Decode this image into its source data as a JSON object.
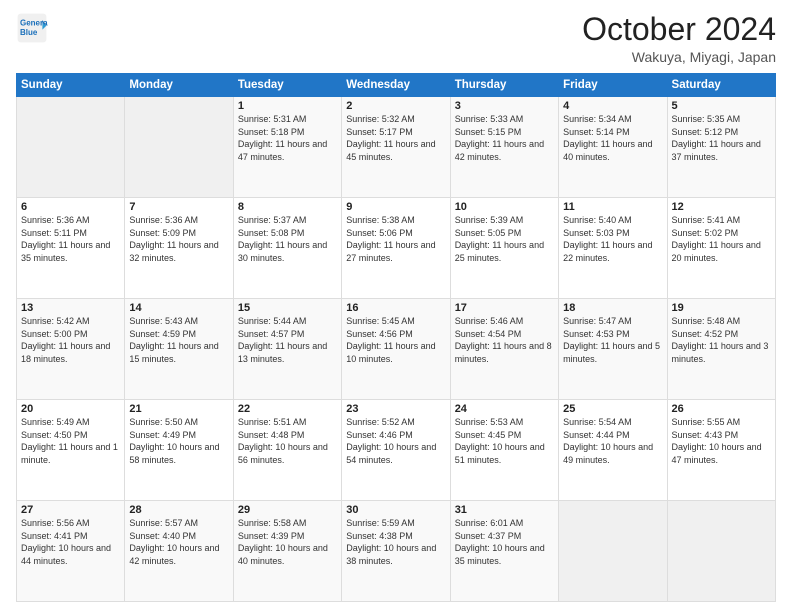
{
  "header": {
    "logo_line1": "General",
    "logo_line2": "Blue",
    "month": "October 2024",
    "location": "Wakuya, Miyagi, Japan"
  },
  "weekdays": [
    "Sunday",
    "Monday",
    "Tuesday",
    "Wednesday",
    "Thursday",
    "Friday",
    "Saturday"
  ],
  "weeks": [
    [
      {
        "day": "",
        "data": ""
      },
      {
        "day": "",
        "data": ""
      },
      {
        "day": "1",
        "data": "Sunrise: 5:31 AM\nSunset: 5:18 PM\nDaylight: 11 hours and 47 minutes."
      },
      {
        "day": "2",
        "data": "Sunrise: 5:32 AM\nSunset: 5:17 PM\nDaylight: 11 hours and 45 minutes."
      },
      {
        "day": "3",
        "data": "Sunrise: 5:33 AM\nSunset: 5:15 PM\nDaylight: 11 hours and 42 minutes."
      },
      {
        "day": "4",
        "data": "Sunrise: 5:34 AM\nSunset: 5:14 PM\nDaylight: 11 hours and 40 minutes."
      },
      {
        "day": "5",
        "data": "Sunrise: 5:35 AM\nSunset: 5:12 PM\nDaylight: 11 hours and 37 minutes."
      }
    ],
    [
      {
        "day": "6",
        "data": "Sunrise: 5:36 AM\nSunset: 5:11 PM\nDaylight: 11 hours and 35 minutes."
      },
      {
        "day": "7",
        "data": "Sunrise: 5:36 AM\nSunset: 5:09 PM\nDaylight: 11 hours and 32 minutes."
      },
      {
        "day": "8",
        "data": "Sunrise: 5:37 AM\nSunset: 5:08 PM\nDaylight: 11 hours and 30 minutes."
      },
      {
        "day": "9",
        "data": "Sunrise: 5:38 AM\nSunset: 5:06 PM\nDaylight: 11 hours and 27 minutes."
      },
      {
        "day": "10",
        "data": "Sunrise: 5:39 AM\nSunset: 5:05 PM\nDaylight: 11 hours and 25 minutes."
      },
      {
        "day": "11",
        "data": "Sunrise: 5:40 AM\nSunset: 5:03 PM\nDaylight: 11 hours and 22 minutes."
      },
      {
        "day": "12",
        "data": "Sunrise: 5:41 AM\nSunset: 5:02 PM\nDaylight: 11 hours and 20 minutes."
      }
    ],
    [
      {
        "day": "13",
        "data": "Sunrise: 5:42 AM\nSunset: 5:00 PM\nDaylight: 11 hours and 18 minutes."
      },
      {
        "day": "14",
        "data": "Sunrise: 5:43 AM\nSunset: 4:59 PM\nDaylight: 11 hours and 15 minutes."
      },
      {
        "day": "15",
        "data": "Sunrise: 5:44 AM\nSunset: 4:57 PM\nDaylight: 11 hours and 13 minutes."
      },
      {
        "day": "16",
        "data": "Sunrise: 5:45 AM\nSunset: 4:56 PM\nDaylight: 11 hours and 10 minutes."
      },
      {
        "day": "17",
        "data": "Sunrise: 5:46 AM\nSunset: 4:54 PM\nDaylight: 11 hours and 8 minutes."
      },
      {
        "day": "18",
        "data": "Sunrise: 5:47 AM\nSunset: 4:53 PM\nDaylight: 11 hours and 5 minutes."
      },
      {
        "day": "19",
        "data": "Sunrise: 5:48 AM\nSunset: 4:52 PM\nDaylight: 11 hours and 3 minutes."
      }
    ],
    [
      {
        "day": "20",
        "data": "Sunrise: 5:49 AM\nSunset: 4:50 PM\nDaylight: 11 hours and 1 minute."
      },
      {
        "day": "21",
        "data": "Sunrise: 5:50 AM\nSunset: 4:49 PM\nDaylight: 10 hours and 58 minutes."
      },
      {
        "day": "22",
        "data": "Sunrise: 5:51 AM\nSunset: 4:48 PM\nDaylight: 10 hours and 56 minutes."
      },
      {
        "day": "23",
        "data": "Sunrise: 5:52 AM\nSunset: 4:46 PM\nDaylight: 10 hours and 54 minutes."
      },
      {
        "day": "24",
        "data": "Sunrise: 5:53 AM\nSunset: 4:45 PM\nDaylight: 10 hours and 51 minutes."
      },
      {
        "day": "25",
        "data": "Sunrise: 5:54 AM\nSunset: 4:44 PM\nDaylight: 10 hours and 49 minutes."
      },
      {
        "day": "26",
        "data": "Sunrise: 5:55 AM\nSunset: 4:43 PM\nDaylight: 10 hours and 47 minutes."
      }
    ],
    [
      {
        "day": "27",
        "data": "Sunrise: 5:56 AM\nSunset: 4:41 PM\nDaylight: 10 hours and 44 minutes."
      },
      {
        "day": "28",
        "data": "Sunrise: 5:57 AM\nSunset: 4:40 PM\nDaylight: 10 hours and 42 minutes."
      },
      {
        "day": "29",
        "data": "Sunrise: 5:58 AM\nSunset: 4:39 PM\nDaylight: 10 hours and 40 minutes."
      },
      {
        "day": "30",
        "data": "Sunrise: 5:59 AM\nSunset: 4:38 PM\nDaylight: 10 hours and 38 minutes."
      },
      {
        "day": "31",
        "data": "Sunrise: 6:01 AM\nSunset: 4:37 PM\nDaylight: 10 hours and 35 minutes."
      },
      {
        "day": "",
        "data": ""
      },
      {
        "day": "",
        "data": ""
      }
    ]
  ]
}
